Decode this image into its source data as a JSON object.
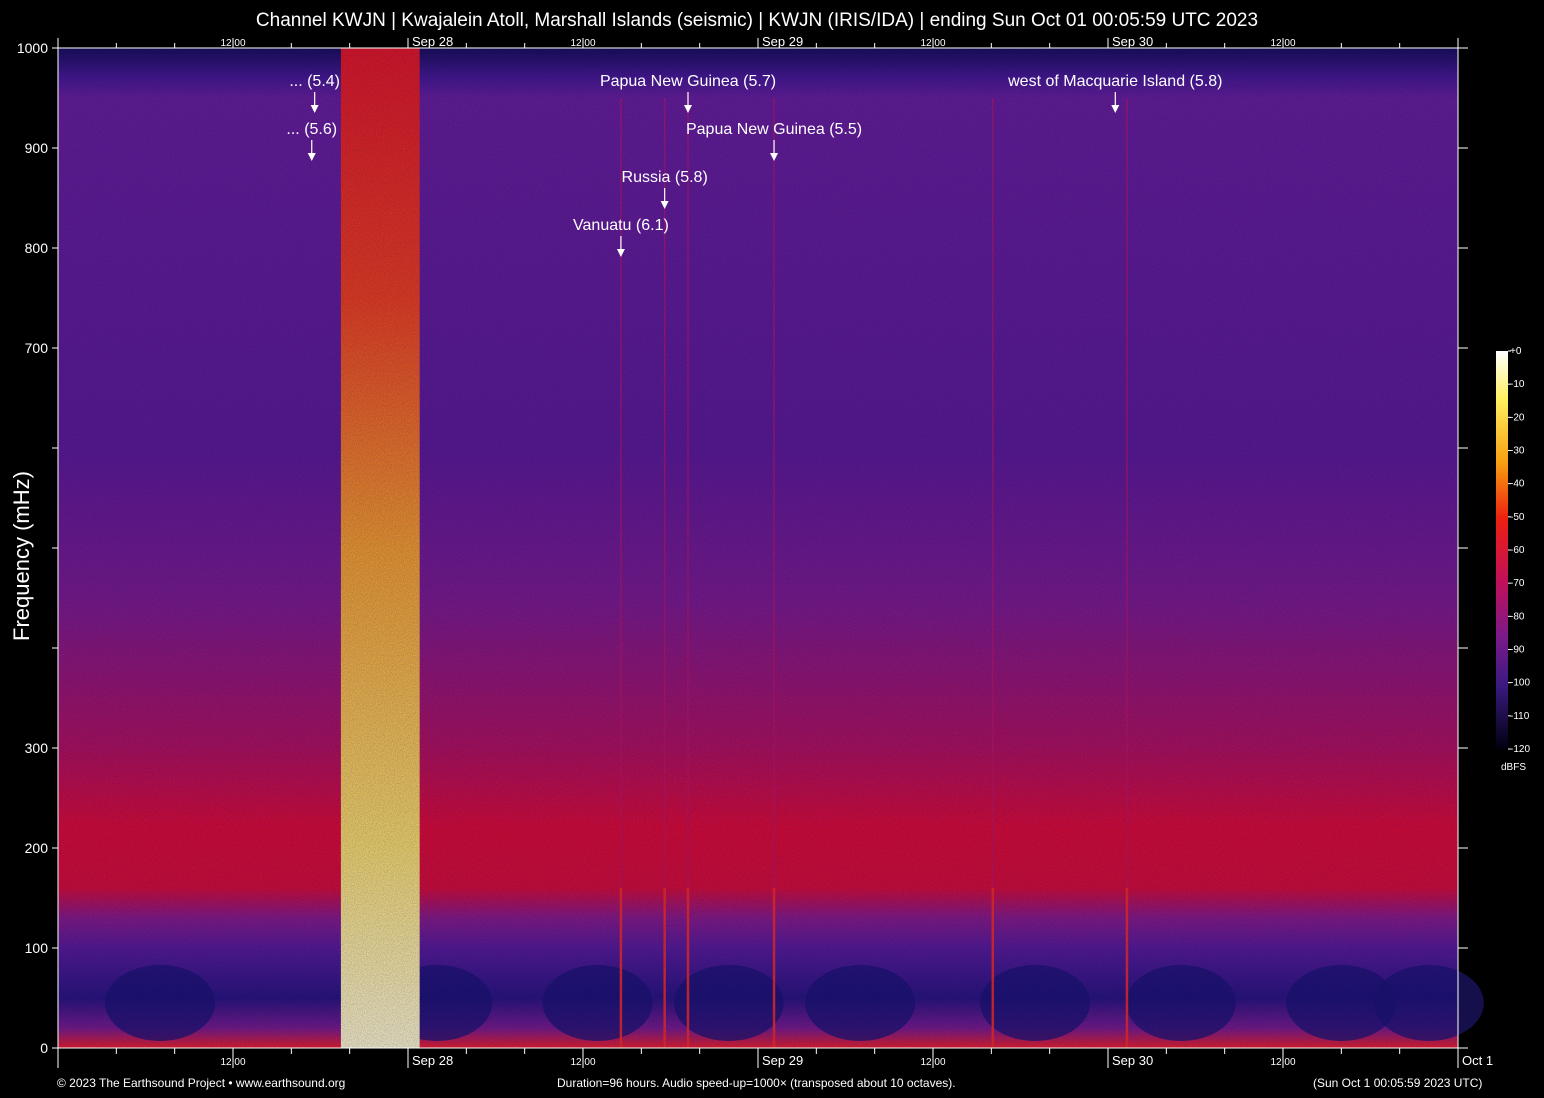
{
  "title": "Channel KWJN | Kwajalein Atoll, Marshall Islands (seismic) | KWJN (IRIS/IDA) | ending Sun Oct 01 00:05:59 UTC 2023",
  "footer": {
    "left": "© 2023 The Earthsound Project • www.earthsound.org",
    "center": "Duration=96 hours. Audio speed-up=1000× (transposed about 10 octaves).",
    "right": "(Sun Oct  1 00:05:59 2023 UTC)"
  },
  "chart_data": {
    "type": "heatmap",
    "title": "Channel KWJN | Kwajalein Atoll, Marshall Islands (seismic) | KWJN (IRIS/IDA) | ending Sun Oct 01 00:05:59 UTC 2023",
    "ylabel": "Frequency (mHz)",
    "xlabel": "",
    "ylim": [
      0,
      1000
    ],
    "y_ticks": [
      0,
      100,
      200,
      300,
      400,
      500,
      600,
      700,
      800,
      900,
      1000
    ],
    "y_tick_labels": [
      "0",
      "100",
      "200",
      "300",
      "",
      "",
      "",
      "700",
      "800",
      "900",
      "1000"
    ],
    "x_range_hours": [
      0,
      96
    ],
    "x_ticks_hours": [
      0,
      12,
      24,
      36,
      48,
      60,
      72,
      84,
      96
    ],
    "x_tick_labels": [
      "",
      "12:00",
      "Sep 28",
      "12:00",
      "Sep 29",
      "12:00",
      "Sep 30",
      "12:00",
      "Oct  1"
    ],
    "x_tick_labels_top": [
      "",
      "12:00",
      "Sep 28",
      "12:00",
      "Sep 29",
      "12:00",
      "Sep 30",
      "12:00",
      ""
    ],
    "colorbar": {
      "unit": "dBFS",
      "range": [
        -120,
        0
      ],
      "ticks": [
        "+0",
        "-10",
        "-20",
        "-30",
        "-40",
        "-50",
        "-60",
        "-70",
        "-80",
        "-90",
        "-100",
        "-110",
        "-120"
      ]
    },
    "events": [
      {
        "label": "... (5.4)",
        "hour": 17.6
      },
      {
        "label": "... (5.6)",
        "hour": 17.4
      },
      {
        "label": "Papua New Guinea (5.7)",
        "hour": 43.2
      },
      {
        "label": "Papua New Guinea (5.5)",
        "hour": 49.1
      },
      {
        "label": "Russia (5.8)",
        "hour": 41.6
      },
      {
        "label": "Vanuatu (6.1)",
        "hour": 38.6
      },
      {
        "label": "west of Macquarie Island (5.8)",
        "hour": 72.5
      }
    ]
  }
}
